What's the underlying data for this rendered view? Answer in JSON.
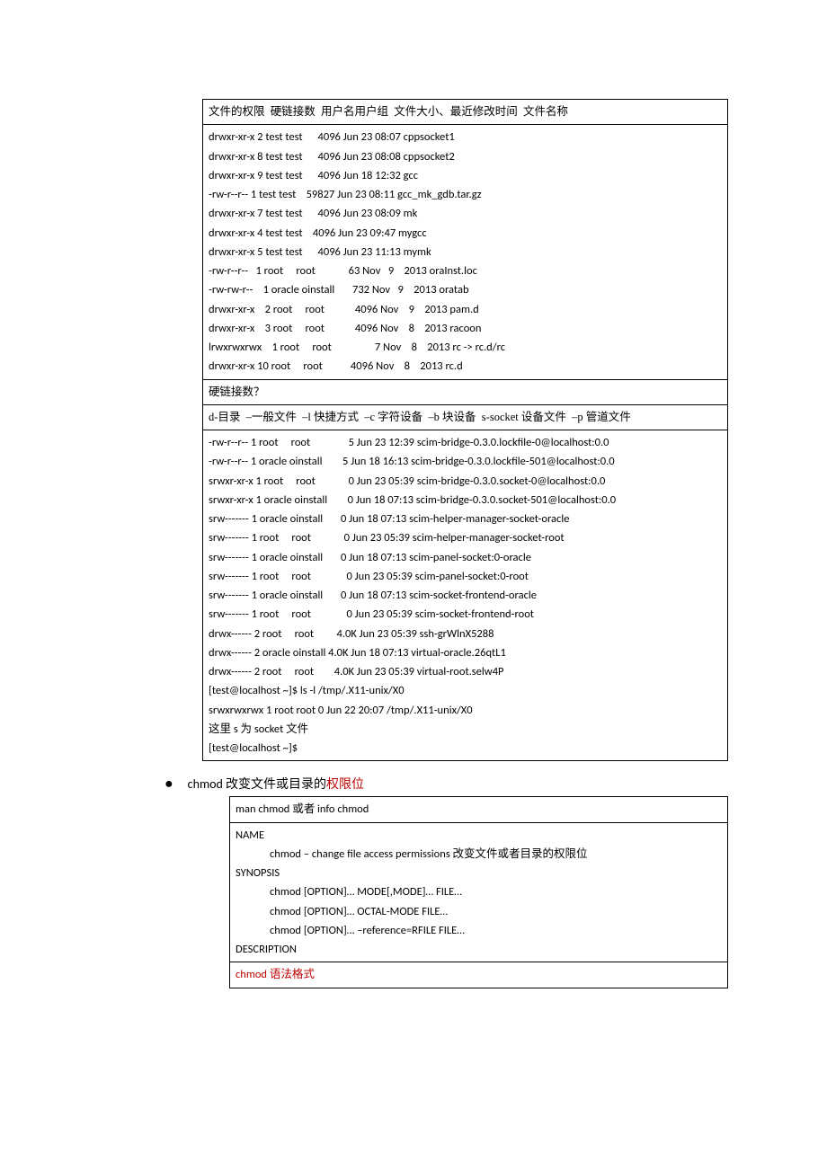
{
  "box1": {
    "r1": "文件的权限  硬链接数  用户名用户组  文件大小、最近修改时间  文件名称",
    "r2": "drwxr-xr-x 2 test test      4096 Jun 23 08:07 cppsocket1\ndrwxr-xr-x 8 test test      4096 Jun 23 08:08 cppsocket2\ndrwxr-xr-x 9 test test      4096 Jun 18 12:32 gcc\n-rw-r--r-- 1 test test    59827 Jun 23 08:11 gcc_mk_gdb.tar.gz\ndrwxr-xr-x 7 test test      4096 Jun 23 08:09 mk\ndrwxr-xr-x 4 test test    4096 Jun 23 09:47 mygcc\ndrwxr-xr-x 5 test test      4096 Jun 23 11:13 mymk\n-rw-r--r--   1 root     root             63 Nov   9    2013 oraInst.loc\n-rw-rw-r--    1 oracle oinstall       732 Nov   9    2013 oratab\ndrwxr-xr-x    2 root     root            4096 Nov    9    2013 pam.d\ndrwxr-xr-x    3 root     root            4096 Nov    8    2013 racoon\nlrwxrwxrwx    1 root     root                 7 Nov    8    2013 rc -> rc.d/rc\ndrwxr-xr-x 10 root     root           4096 Nov    8    2013 rc.d",
    "r3": "硬链接数？",
    "r4": "d-目录  –一般文件  –l 快捷方式  –c 字符设备  –b 块设备  s-socket 设备文件  –p 管道文件",
    "r5": "-rw-r--r-- 1 root     root               5 Jun 23 12:39 scim-bridge-0.3.0.lockfile-0@localhost:0.0\n-rw-r--r-- 1 oracle oinstall        5 Jun 18 16:13 scim-bridge-0.3.0.lockfile-501@localhost:0.0\nsrwxr-xr-x 1 root     root             0 Jun 23 05:39 scim-bridge-0.3.0.socket-0@localhost:0.0\nsrwxr-xr-x 1 oracle oinstall        0 Jun 18 07:13 scim-bridge-0.3.0.socket-501@localhost:0.0\nsrw------- 1 oracle oinstall       0 Jun 18 07:13 scim-helper-manager-socket-oracle\nsrw------- 1 root     root             0 Jun 23 05:39 scim-helper-manager-socket-root\nsrw------- 1 oracle oinstall       0 Jun 18 07:13 scim-panel-socket:0-oracle\nsrw------- 1 root     root              0 Jun 23 05:39 scim-panel-socket:0-root\nsrw------- 1 oracle oinstall       0 Jun 18 07:13 scim-socket-frontend-oracle\nsrw------- 1 root     root              0 Jun 23 05:39 scim-socket-frontend-root\ndrwx------ 2 root     root         4.0K Jun 23 05:39 ssh-grWlnX5288\ndrwx------ 2 oracle oinstall 4.0K Jun 18 07:13 virtual-oracle.26qtL1\ndrwx------ 2 root     root        4.0K Jun 23 05:39 virtual-root.selw4P\n[test@localhost ~]$ ls -l /tmp/.X11-unix/X0\nsrwxrwxrwx 1 root root 0 Jun 22 20:07 /tmp/.X11-unix/X0\n这里 s 为 socket 文件\n[test@localhost ~]$"
  },
  "bullet": {
    "pre": "chmod  改变文件或目录的",
    "red": "权限位"
  },
  "box2": {
    "r1": "man chmod  或者  info chmod",
    "r2_name": "NAME",
    "r2_body": "chmod – change file access permissions  改变文件或者目录的权限位",
    "r2_syn": "SYNOPSIS",
    "r2_s1": "chmod [OPTION]… MODE[,MODE]… FILE…",
    "r2_s2": "chmod [OPTION]… OCTAL-MODE FILE…",
    "r2_s3": "chmod [OPTION]… –reference=RFILE FILE…",
    "r2_desc": "DESCRIPTION",
    "r3": "chmod 语法格式"
  }
}
